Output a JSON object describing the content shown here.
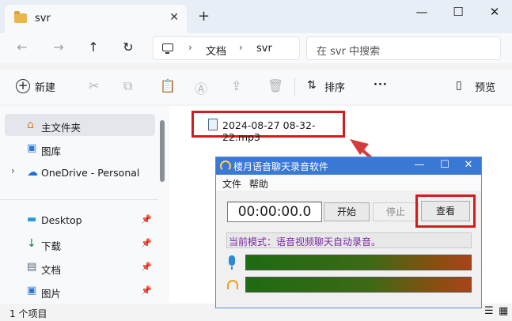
{
  "tab": {
    "title": "svr",
    "close": "✕",
    "new_tab": "+"
  },
  "window": {
    "minimize": "—",
    "maximize": "☐",
    "close": "✕"
  },
  "nav": {
    "back": "←",
    "forward": "→",
    "up": "↑",
    "refresh": "↻"
  },
  "breadcrumb": {
    "sep": "›",
    "items": [
      "文档",
      "svr"
    ]
  },
  "search": {
    "placeholder": "在 svr 中搜索"
  },
  "toolbar": {
    "new_label": "新建",
    "sort_label": "排序",
    "more": "···",
    "preview_label": "预览"
  },
  "sidebar": {
    "items": [
      {
        "label": "主文件夹"
      },
      {
        "label": "图库"
      },
      {
        "label": "OneDrive - Personal"
      },
      {
        "label": "Desktop"
      },
      {
        "label": "下载"
      },
      {
        "label": "文档"
      },
      {
        "label": "图片"
      }
    ],
    "pin": "📌"
  },
  "file": {
    "name": "2024-08-27 08-32-22.mp3"
  },
  "status": {
    "count": "1 个项目"
  },
  "recorder": {
    "title": "楼月语音聊天录音软件",
    "menu_file": "文件",
    "menu_help": "帮助",
    "timer": "00:00:00.0",
    "start": "开始",
    "stop": "停止",
    "view": "查看",
    "mode": "当前模式：语音视频聊天自动录音。",
    "minimize": "—",
    "maximize": "☐",
    "close": "✕"
  },
  "colors": {
    "highlight": "#d21c1c",
    "title_bar": "#3a78d6",
    "mode_text": "#7a2aa0"
  }
}
